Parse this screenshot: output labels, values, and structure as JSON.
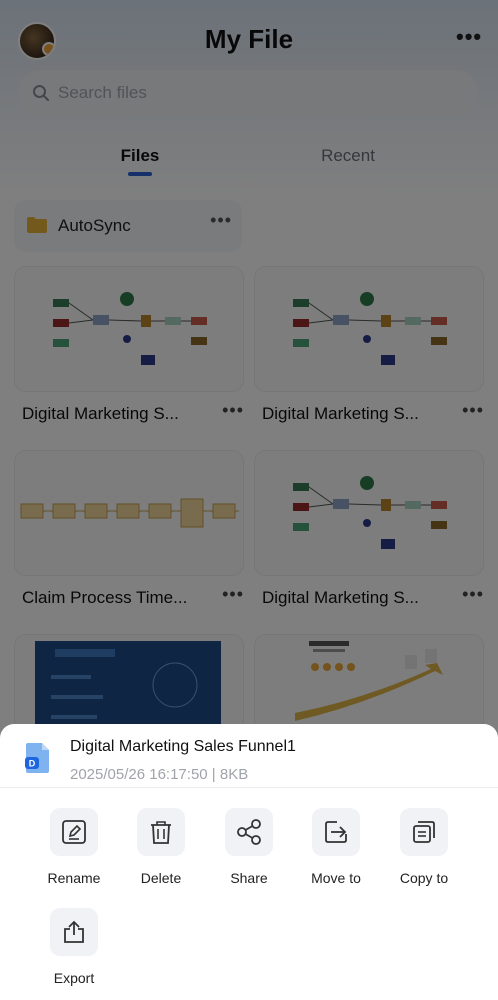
{
  "header": {
    "title": "My File",
    "more_label": "•••"
  },
  "search": {
    "placeholder": "Search files"
  },
  "tabs": [
    {
      "label": "Files"
    },
    {
      "label": "Recent"
    }
  ],
  "folder": {
    "name": "AutoSync",
    "more_label": "•••"
  },
  "cards": [
    {
      "name": "Digital Marketing S...",
      "more_label": "•••",
      "thumb": "funnel"
    },
    {
      "name": "Digital Marketing S...",
      "more_label": "•••",
      "thumb": "funnel"
    },
    {
      "name": "Claim Process Time...",
      "more_label": "•••",
      "thumb": "timeline"
    },
    {
      "name": "Digital Marketing S...",
      "more_label": "•••",
      "thumb": "funnel"
    },
    {
      "name": "",
      "more_label": "",
      "thumb": "blueprint"
    },
    {
      "name": "",
      "more_label": "",
      "thumb": "infographic"
    }
  ],
  "sheet": {
    "file_title": "Digital Marketing Sales Funnel1",
    "file_meta": "2025/05/26 16:17:50 | 8KB",
    "actions": [
      {
        "label": "Rename",
        "icon": "edit-icon"
      },
      {
        "label": "Delete",
        "icon": "trash-icon"
      },
      {
        "label": "Share",
        "icon": "share-icon"
      },
      {
        "label": "Move to",
        "icon": "move-icon"
      },
      {
        "label": "Copy to",
        "icon": "copy-icon"
      },
      {
        "label": "Export",
        "icon": "export-icon"
      }
    ]
  },
  "colors": {
    "accent": "#2b60d6",
    "overlay": "rgba(0,0,0,0.5)"
  }
}
